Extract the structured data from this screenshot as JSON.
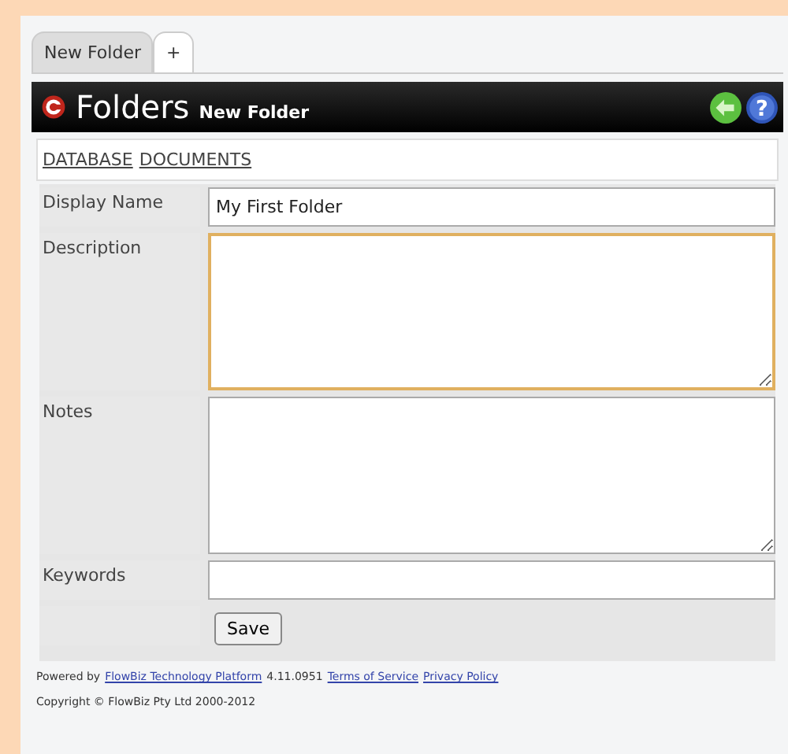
{
  "tabs": [
    {
      "label": "New Folder",
      "selected": true
    },
    {
      "label": "+",
      "selected": false
    }
  ],
  "header": {
    "title": "Folders",
    "subtitle": "New Folder",
    "help_icon": "?"
  },
  "nav_links": [
    "DATABASE",
    "DOCUMENTS"
  ],
  "fields": [
    {
      "label": "Display Name",
      "kind": "input",
      "value": "My First Folder",
      "focused": false
    },
    {
      "label": "Description",
      "kind": "textarea",
      "focused": true
    },
    {
      "label": "Notes",
      "kind": "textarea",
      "focused": false
    },
    {
      "label": "Keywords",
      "kind": "input",
      "focused": false
    }
  ],
  "save_button": "Save",
  "footer": {
    "powered_by": "Powered by",
    "platform_link": "FlowBiz Technology Platform",
    "version": "4.11.0951",
    "terms_link": "Terms of Service",
    "privacy_link": "Privacy Policy",
    "copyright": "Copyright © FlowBiz Pty Ltd 2000-2012"
  }
}
